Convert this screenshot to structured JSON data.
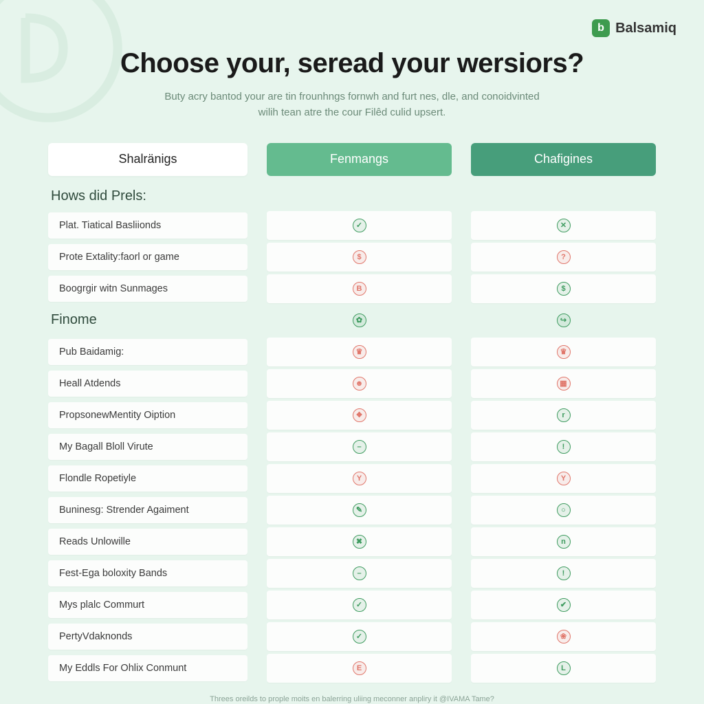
{
  "brand": {
    "name": "Balsamiq",
    "logo_letter": "b"
  },
  "hero": {
    "title": "Choose your, seread your wersiors?",
    "subtitle": "Buty acry bantod your are tin frounhngs fornwh and furt nes, dle, and conoidvinted wilih tean atre the cour Filêd culid upsert."
  },
  "tabs": [
    {
      "id": "shalranigs",
      "label": "Shalränigs",
      "style": "plain"
    },
    {
      "id": "fenmangs",
      "label": "Fenmangs",
      "style": "mid"
    },
    {
      "id": "chafigines",
      "label": "Chafigines",
      "style": "dark"
    }
  ],
  "sections": [
    {
      "title": "Hows did Prels:",
      "rows": [
        {
          "label": "Plat. Tiatical Basliionds",
          "col2": {
            "c": "g",
            "g": "check"
          },
          "col3": {
            "c": "g",
            "g": "x"
          }
        },
        {
          "label": "Prote Extality:faorl or game",
          "col2": {
            "c": "r",
            "g": "dollar"
          },
          "col3": {
            "c": "r",
            "g": "q"
          }
        },
        {
          "label": "Boogrgir witn Sunmages",
          "col2": {
            "c": "r",
            "g": "b"
          },
          "col3": {
            "c": "g",
            "g": "dollar"
          }
        }
      ]
    },
    {
      "title": "Finome",
      "title_icons": {
        "col2": {
          "c": "g",
          "g": "leaf"
        },
        "col3": {
          "c": "g",
          "g": "arrow"
        }
      },
      "rows": [
        {
          "label": "Pub Baidamig:",
          "col2": {
            "c": "r",
            "g": "crown"
          },
          "col3": {
            "c": "r",
            "g": "crown"
          }
        },
        {
          "label": "Heall Atdends",
          "col2": {
            "c": "r",
            "g": "face"
          },
          "col3": {
            "c": "r",
            "g": "gift"
          }
        },
        {
          "label": "PropsonewMentity Oiption",
          "col2": {
            "c": "r",
            "g": "cube"
          },
          "col3": {
            "c": "g",
            "g": "r"
          }
        },
        {
          "label": "My Bagall Bloll Virute",
          "col2": {
            "c": "g",
            "g": "dash"
          },
          "col3": {
            "c": "g",
            "g": "bang"
          }
        },
        {
          "label": "Flondle Ropetiyle",
          "col2": {
            "c": "r",
            "g": "trophy"
          },
          "col3": {
            "c": "r",
            "g": "trophy"
          }
        },
        {
          "label": "Buninesg: Strender Agaiment",
          "col2": {
            "c": "g",
            "g": "pen"
          },
          "col3": {
            "c": "g",
            "g": "circle"
          }
        },
        {
          "label": "Reads Unlowille",
          "col2": {
            "c": "g",
            "g": "x2"
          },
          "col3": {
            "c": "g",
            "g": "n"
          }
        },
        {
          "label": "Fest-Ega boloxity Bands",
          "col2": {
            "c": "g",
            "g": "dash"
          },
          "col3": {
            "c": "g",
            "g": "bang"
          }
        },
        {
          "label": "Mys plalc Commurt",
          "col2": {
            "c": "g",
            "g": "check"
          },
          "col3": {
            "c": "g",
            "g": "check2"
          }
        },
        {
          "label": "PertyVdaknonds",
          "col2": {
            "c": "g",
            "g": "check"
          },
          "col3": {
            "c": "r",
            "g": "berry"
          }
        },
        {
          "label": "My Eddls For Ohlix Conmunt",
          "col2": {
            "c": "r",
            "g": "e"
          },
          "col3": {
            "c": "g",
            "g": "l"
          }
        }
      ]
    }
  ],
  "footer": "Threes oreilds to prople moits en balerring uliing meconner anpliry it @IVAMA Tame?"
}
